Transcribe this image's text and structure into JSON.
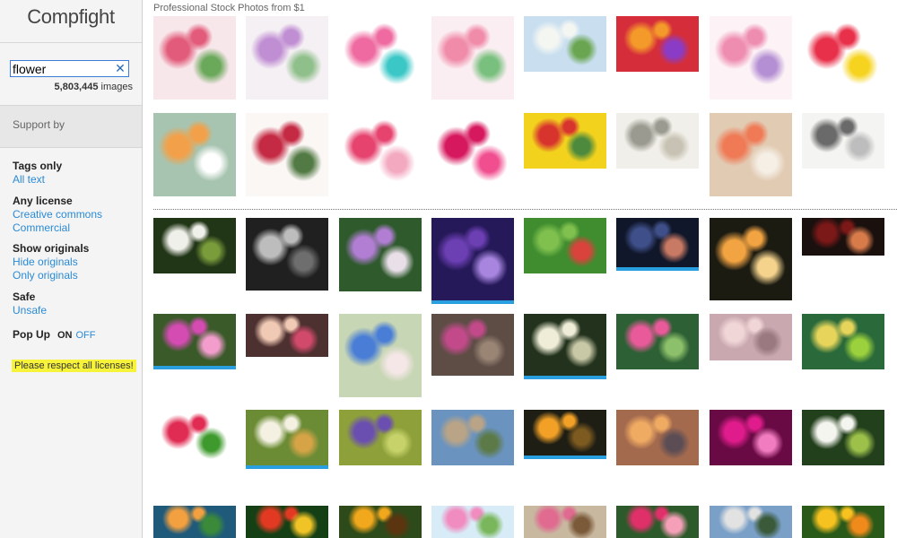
{
  "sidebar": {
    "logo": "Compfight",
    "search": {
      "value": "flower",
      "clear_symbol": "✕"
    },
    "count": {
      "number": "5,803,445",
      "suffix": " images"
    },
    "support_label": "Support by",
    "filters": [
      {
        "heading": "Tags only",
        "links": [
          "All text"
        ]
      },
      {
        "heading": "Any license",
        "links": [
          "Creative commons",
          "Commercial"
        ]
      },
      {
        "heading": "Show originals",
        "links": [
          "Hide originals",
          "Only originals"
        ]
      },
      {
        "heading": "Safe",
        "links": [
          "Unsafe"
        ]
      }
    ],
    "popup": {
      "title": "Pop Up",
      "on": "ON",
      "off": "OFF"
    },
    "respect_notice": "Please respect all licenses!"
  },
  "main": {
    "header": "Professional Stock Photos from $1",
    "stock_rows": [
      [
        {
          "icon": "bouquet-illustration-icon",
          "colors": [
            "#f7e6ea",
            "#e25b7a",
            "#6aa85a"
          ]
        },
        {
          "icon": "thank-you-wreath-icon",
          "colors": [
            "#f5f0f4",
            "#c08ed3",
            "#8fbf8a"
          ]
        },
        {
          "icon": "flower-icons-set-icon",
          "colors": [
            "#ffffff",
            "#ee6aa0",
            "#3cc7c7"
          ]
        },
        {
          "icon": "your-text-here-card-icon",
          "colors": [
            "#fbeef2",
            "#f08caa",
            "#79c07e"
          ]
        },
        {
          "icon": "white-tulips-icon",
          "colors": [
            "#c9dff0",
            "#f4f6f2",
            "#6aa651"
          ]
        },
        {
          "icon": "colorful-flowers-icon",
          "colors": [
            "#d52e3a",
            "#f49a2a",
            "#8a3cc6"
          ]
        },
        {
          "icon": "watercolor-border-icon",
          "colors": [
            "#fdf2f6",
            "#ee8db0",
            "#b48fd3"
          ]
        },
        {
          "icon": "daisy-icons-grid-icon",
          "colors": [
            "#ffffff",
            "#e8304a",
            "#f6d31f"
          ]
        }
      ],
      [
        {
          "icon": "spring-poster-icon",
          "colors": [
            "#a7c4b0",
            "#f2a14a",
            "#ffffff"
          ]
        },
        {
          "icon": "wedding-invitation-icon",
          "colors": [
            "#fbf7f5",
            "#c42a43",
            "#527a44"
          ]
        },
        {
          "icon": "pink-blossom-icon",
          "colors": [
            "#ffffff",
            "#e6436f",
            "#f3a9c0"
          ]
        },
        {
          "icon": "magenta-flower-icons-icon",
          "colors": [
            "#ffffff",
            "#d6185e",
            "#f04e8f"
          ]
        },
        {
          "icon": "yellow-red-bouquet-icon",
          "colors": [
            "#f3d21d",
            "#d8342e",
            "#4d8a3d"
          ]
        },
        {
          "icon": "line-art-herbs-icon",
          "colors": [
            "#f1efe9",
            "#9a9a90",
            "#c7c2b3"
          ]
        },
        {
          "icon": "coral-line-flowers-icon",
          "colors": [
            "#e2cbb3",
            "#ef7a55",
            "#f5efe6"
          ]
        },
        {
          "icon": "botanical-sketch-icon",
          "colors": [
            "#f4f4f2",
            "#6a6a6a",
            "#bdbdbd"
          ]
        }
      ]
    ],
    "photo_rows": [
      [
        {
          "icon": "bee-on-white-flowers-icon",
          "colors": [
            "#213517",
            "#f0f0ea",
            "#7a9c3b"
          ],
          "selected": false
        },
        {
          "icon": "bw-flowers-icon",
          "colors": [
            "#202020",
            "#bdbdbd",
            "#6e6e6e"
          ],
          "selected": false
        },
        {
          "icon": "purple-hydrangea-icon",
          "colors": [
            "#2e5a2c",
            "#b27ed4",
            "#e9dfe9"
          ],
          "selected": false
        },
        {
          "icon": "purple-orchid-icon",
          "colors": [
            "#26195a",
            "#6c3fb3",
            "#a886e0"
          ],
          "selected": true
        },
        {
          "icon": "green-leaf-icon",
          "colors": [
            "#3f8d2f",
            "#7fc04e",
            "#d9433b"
          ],
          "selected": false
        },
        {
          "icon": "night-blossom-icon",
          "colors": [
            "#10172a",
            "#3f4f8a",
            "#c97a64"
          ],
          "selected": true
        },
        {
          "icon": "orange-roses-icon",
          "colors": [
            "#1b1b12",
            "#f3a442",
            "#f5d38d"
          ],
          "selected": false
        },
        {
          "icon": "dark-red-flower-icon",
          "colors": [
            "#1a100e",
            "#7b1818",
            "#d87b4b"
          ],
          "selected": false
        }
      ],
      [
        {
          "icon": "pink-blooms-icon",
          "colors": [
            "#3b5a2a",
            "#d44bb2",
            "#f29dcc"
          ],
          "selected": true
        },
        {
          "icon": "flower-crown-girls-icon",
          "colors": [
            "#4d3030",
            "#f0cab4",
            "#d14a6b"
          ],
          "selected": false
        },
        {
          "icon": "blue-butterfly-icon",
          "colors": [
            "#c7d6b4",
            "#4a7ed6",
            "#f5e7e7"
          ],
          "selected": false
        },
        {
          "icon": "house-with-bougainvillea-icon",
          "colors": [
            "#5d4d45",
            "#c24a8a",
            "#9a8575"
          ],
          "selected": false
        },
        {
          "icon": "white-rose-icon",
          "colors": [
            "#22321c",
            "#efedd8",
            "#c8c8a7"
          ],
          "selected": true
        },
        {
          "icon": "pink-lotus-icon",
          "colors": [
            "#2d6034",
            "#e95a9a",
            "#8dc06a"
          ],
          "selected": false
        },
        {
          "icon": "misty-trees-icon",
          "colors": [
            "#c9a8b0",
            "#f0d6d6",
            "#9a7a80"
          ],
          "selected": false
        },
        {
          "icon": "yellow-bokeh-plant-icon",
          "colors": [
            "#2a6a3a",
            "#e6d55a",
            "#9bd13c"
          ],
          "selected": false
        }
      ],
      [
        {
          "icon": "red-tulips-icon",
          "colors": [
            "#ffffff",
            "#e02b52",
            "#3f9a2e"
          ],
          "selected": false
        },
        {
          "icon": "white-petals-icon",
          "colors": [
            "#6b8c35",
            "#f4f1e2",
            "#d6a447"
          ],
          "selected": true
        },
        {
          "icon": "purple-wildflowers-icon",
          "colors": [
            "#8ea03a",
            "#6a4fb0",
            "#c7d36a"
          ],
          "selected": false
        },
        {
          "icon": "mountain-village-icon",
          "colors": [
            "#6a93bf",
            "#b9a487",
            "#5c7a47"
          ],
          "selected": false
        },
        {
          "icon": "orange-protea-icon",
          "colors": [
            "#1e1e14",
            "#f2a126",
            "#7d5a20"
          ],
          "selected": true
        },
        {
          "icon": "misty-street-icon",
          "colors": [
            "#a46a4e",
            "#f0ab62",
            "#5c4d54"
          ],
          "selected": false
        },
        {
          "icon": "pink-water-drops-icon",
          "colors": [
            "#6a0a45",
            "#e01c8c",
            "#f27cc0"
          ],
          "selected": false
        },
        {
          "icon": "bee-on-queen-annes-lace-icon",
          "colors": [
            "#23401d",
            "#f5f5ef",
            "#9cc04a"
          ],
          "selected": false
        }
      ],
      [
        {
          "icon": "butterfly-on-flower-icon",
          "colors": [
            "#1f5a7a",
            "#f2a040",
            "#3a8a3a"
          ],
          "selected": false
        },
        {
          "icon": "red-yellow-flower-icon",
          "colors": [
            "#154015",
            "#e23a22",
            "#f0c326"
          ],
          "selected": false
        },
        {
          "icon": "black-eyed-susan-icon",
          "colors": [
            "#2c4a1a",
            "#f2a81c",
            "#5a3510"
          ],
          "selected": false
        },
        {
          "icon": "cosmos-flowers-icon",
          "colors": [
            "#d7ecf7",
            "#f08cbf",
            "#7ab75c"
          ],
          "selected": false
        },
        {
          "icon": "moth-on-petals-icon",
          "colors": [
            "#c8b8a0",
            "#e06a90",
            "#7b5a3a"
          ],
          "selected": false
        },
        {
          "icon": "pink-lilies-icon",
          "colors": [
            "#2d5a2a",
            "#e0306a",
            "#f5a0b8"
          ],
          "selected": false
        },
        {
          "icon": "seaside-houses-icon",
          "colors": [
            "#7aa0c8",
            "#e2e2e2",
            "#3a5a3a"
          ],
          "selected": false
        },
        {
          "icon": "yellow-tulips-icon",
          "colors": [
            "#2a5a1a",
            "#f6c21f",
            "#f08a1a"
          ],
          "selected": false
        }
      ]
    ]
  }
}
